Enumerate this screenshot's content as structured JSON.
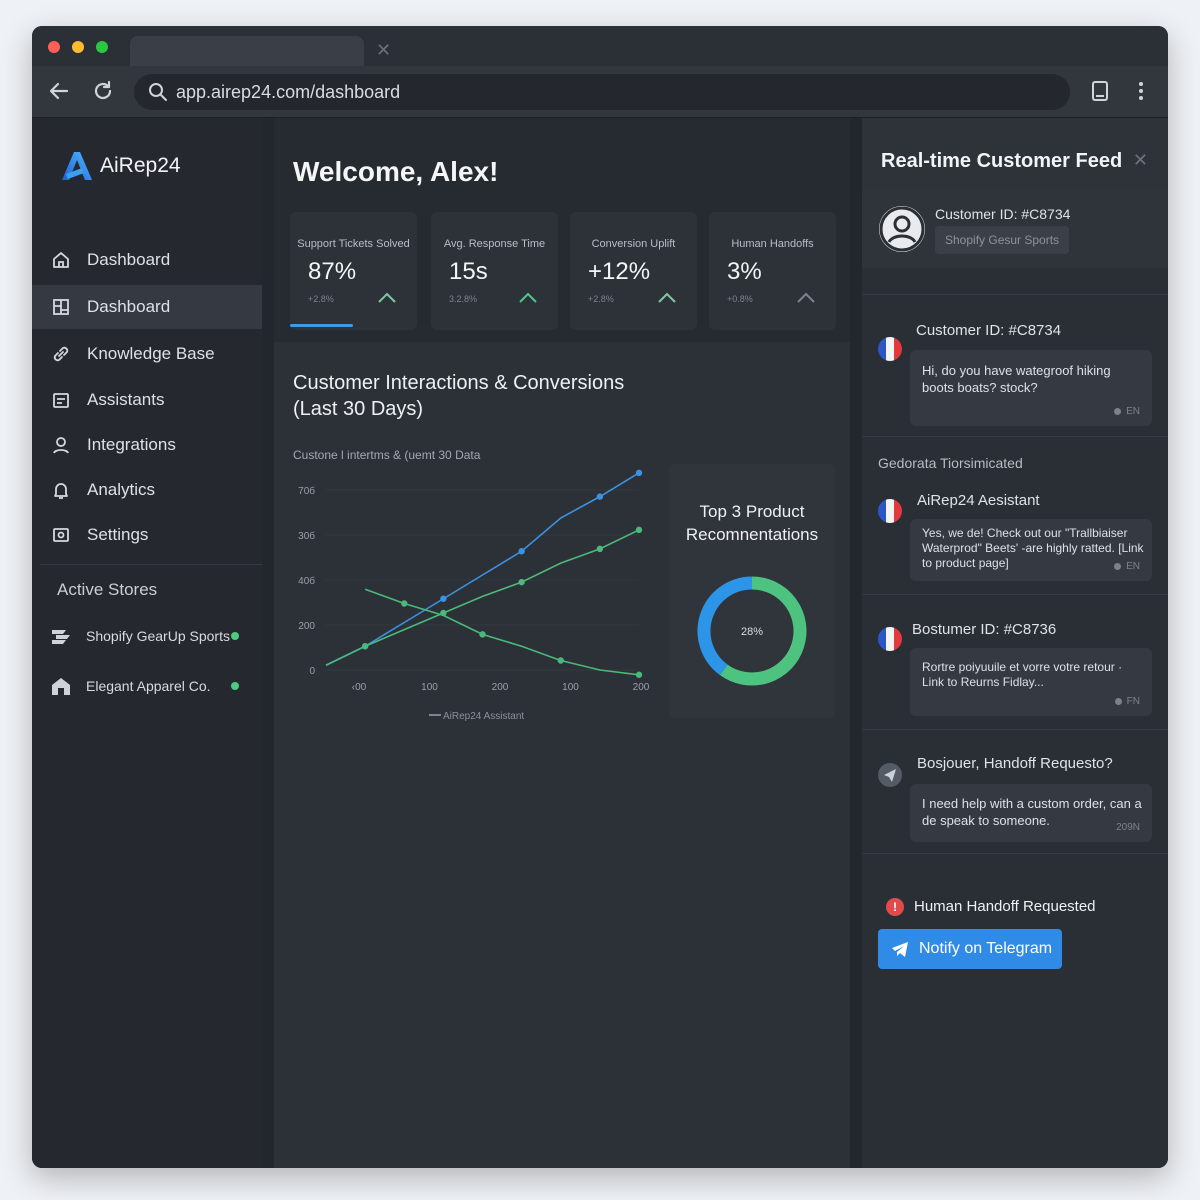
{
  "browser": {
    "url": "app.airep24.com/dashboard",
    "traffic_lights": [
      "#ff5f57",
      "#febc2e",
      "#28c840"
    ]
  },
  "sidebar": {
    "brand": "AiRep24",
    "nav": [
      {
        "label": "Dashboard",
        "icon": "home-icon"
      },
      {
        "label": "Dashboard",
        "icon": "dashboard-icon",
        "active": true
      },
      {
        "label": "Knowledge Base",
        "icon": "link-icon"
      },
      {
        "label": "Assistants",
        "icon": "assistant-icon"
      },
      {
        "label": "Integrations",
        "icon": "user-icon"
      },
      {
        "label": "Analytics",
        "icon": "bell-icon"
      },
      {
        "label": "Settings",
        "icon": "settings-icon"
      }
    ],
    "stores_title": "Active Stores",
    "stores": [
      {
        "name": "Shopify GearUp Sports",
        "status": "active"
      },
      {
        "name": "Elegant Apparel Co.",
        "status": "active"
      }
    ]
  },
  "main": {
    "welcome": "Welcome, Alex!",
    "kpis": [
      {
        "label": "Support Tickets Solved",
        "value": "87%",
        "delta": "+2.8%"
      },
      {
        "label": "Avg. Response Time",
        "value": "15s",
        "delta": "3.2.8%"
      },
      {
        "label": "Conversion Uplift",
        "value": "+12%",
        "delta": "+2.8%"
      },
      {
        "label": "Human Handoffs",
        "value": "3%",
        "delta": "+0.8%"
      }
    ],
    "chart_title": "Customer Interactions & Conversions (Last 30 Days)",
    "chart_subtitle": "Custone l intertms & (uemt 30 Datа",
    "recommendations_title": "Top 3 Product Recomnentations",
    "donut_label": "28%"
  },
  "chart_data": [
    {
      "type": "line",
      "title": "Customer Interactions & Conversions (Last 30 Days)",
      "subtitle": "Custone l intertms & (uemt 30 Datа",
      "x": [
        0,
        1,
        2,
        3,
        4,
        5,
        6,
        7,
        8
      ],
      "x_tick_labels": [
        "‹00",
        "100",
        "200",
        "100",
        "200"
      ],
      "y_tick_labels": [
        "0",
        "200",
        "40б",
        "30б",
        "70б"
      ],
      "ylim": [
        0,
        800
      ],
      "series": [
        {
          "values": [
            20,
            100,
            200,
            300,
            400,
            500,
            640,
            730,
            830
          ],
          "color": "#3b92e0"
        },
        {
          "values": [
            20,
            100,
            170,
            240,
            310,
            370,
            450,
            510,
            590
          ],
          "color": "#4ab97a"
        },
        {
          "values": [
            null,
            340,
            280,
            230,
            150,
            100,
            40,
            0,
            -20
          ],
          "color": "#4ab97a"
        }
      ],
      "legend": "—AiRep24 Assistant",
      "legend_position": "bottom"
    },
    {
      "type": "pie",
      "title": "Top 3 Product Recomnentations",
      "center_label": "28%",
      "slices": [
        {
          "value": 60,
          "color": "#4ec27f"
        },
        {
          "value": 40,
          "color": "#2c95e8"
        }
      ]
    }
  ],
  "feed": {
    "title": "Real-time Customer Feed",
    "customer_id": "Customer ID: #C8734",
    "store_chip": "Shopify Gesur Sports",
    "messages": [
      {
        "name": "Customer ID: #C8734",
        "text": "Hi, do you have wategroof hiking boots boats? stock?",
        "lang": "EN",
        "flag": "fr"
      },
      {
        "name": "AiRep24 Aesistant",
        "text": "Yes, we de! Check out our \"Trallbiaiser Waterprod\" Beets' -are highly ratted. [Link to product page]",
        "lang": "EN",
        "flag": "fr"
      },
      {
        "name": "Bostumer ID: #C8736",
        "text": "Rortre poiyuuile et vorre votre retour · Link to Reurns Fidlay...",
        "lang": "FN",
        "flag": "fr"
      },
      {
        "name": "Bosjouer, Handoff Requesto?",
        "text": "I need help with a custom order, can a de speak to someone.",
        "lang": "209N",
        "icon": "send-icon"
      }
    ],
    "note": "Gedorata Tiorsimicated",
    "handoff_label": "Human Handoff Requested",
    "telegram_button": "Notify on Telegram"
  },
  "colors": {
    "accent": "#2f8be6",
    "green": "#4ccb7f",
    "alert": "#e14b4b"
  }
}
